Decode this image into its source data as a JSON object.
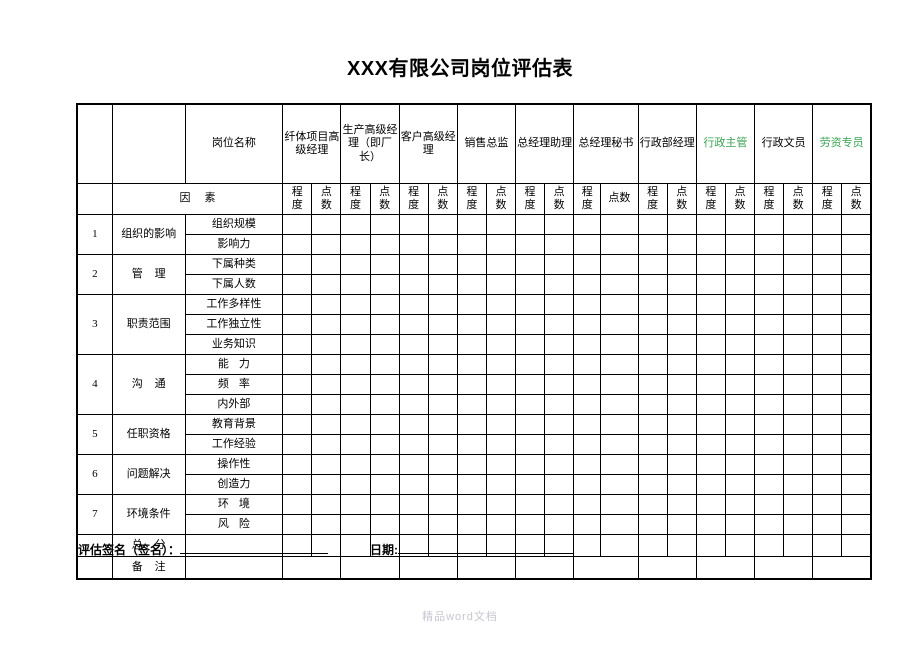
{
  "document": {
    "title": "XXX有限公司岗位评估表",
    "watermark": "精品word文档"
  },
  "table": {
    "post_label": "岗位名称",
    "factor_header": "因素",
    "degree_label": "程度",
    "points_label": "点数",
    "jobs": [
      {
        "name": "纤体项目高级经理",
        "color": "#000000",
        "wide_points": false
      },
      {
        "name": "生产高级经理（即厂长）",
        "color": "#000000",
        "wide_points": false
      },
      {
        "name": "客户高级经理",
        "color": "#000000",
        "wide_points": false
      },
      {
        "name": "销售总监",
        "color": "#000000",
        "wide_points": false
      },
      {
        "name": "总经理助理",
        "color": "#000000",
        "wide_points": false
      },
      {
        "name": "总经理秘书",
        "color": "#000000",
        "wide_points": true
      },
      {
        "name": "行政部经理",
        "color": "#000000",
        "wide_points": false
      },
      {
        "name": "行政主管",
        "color": "#3aa355",
        "wide_points": false
      },
      {
        "name": "行政文员",
        "color": "#000000",
        "wide_points": false
      },
      {
        "name": "劳资专员",
        "color": "#3aa355",
        "wide_points": false
      }
    ],
    "groups": [
      {
        "index": "1",
        "name": "组织的影响",
        "subs": [
          "组织规模",
          "影响力"
        ]
      },
      {
        "index": "2",
        "name": "管理",
        "spaced": true,
        "subs": [
          "下属种类",
          "下属人数"
        ]
      },
      {
        "index": "3",
        "name": "职责范围",
        "subs": [
          "工作多样性",
          "工作独立性",
          "业务知识"
        ]
      },
      {
        "index": "4",
        "name": "沟通",
        "spaced": true,
        "subs": [
          "能力",
          "频率",
          "内外部"
        ]
      },
      {
        "index": "5",
        "name": "任职资格",
        "subs": [
          "教育背景",
          "工作经验"
        ]
      },
      {
        "index": "6",
        "name": "问题解决",
        "subs": [
          "操作性",
          "创造力"
        ]
      },
      {
        "index": "7",
        "name": "环境条件",
        "subs": [
          "环境",
          "风险"
        ]
      }
    ],
    "total_row_label": "总分",
    "note_row_label": "备注"
  },
  "footer": {
    "signature_label": "评估签名（签名）：",
    "date_label": "日期:"
  }
}
